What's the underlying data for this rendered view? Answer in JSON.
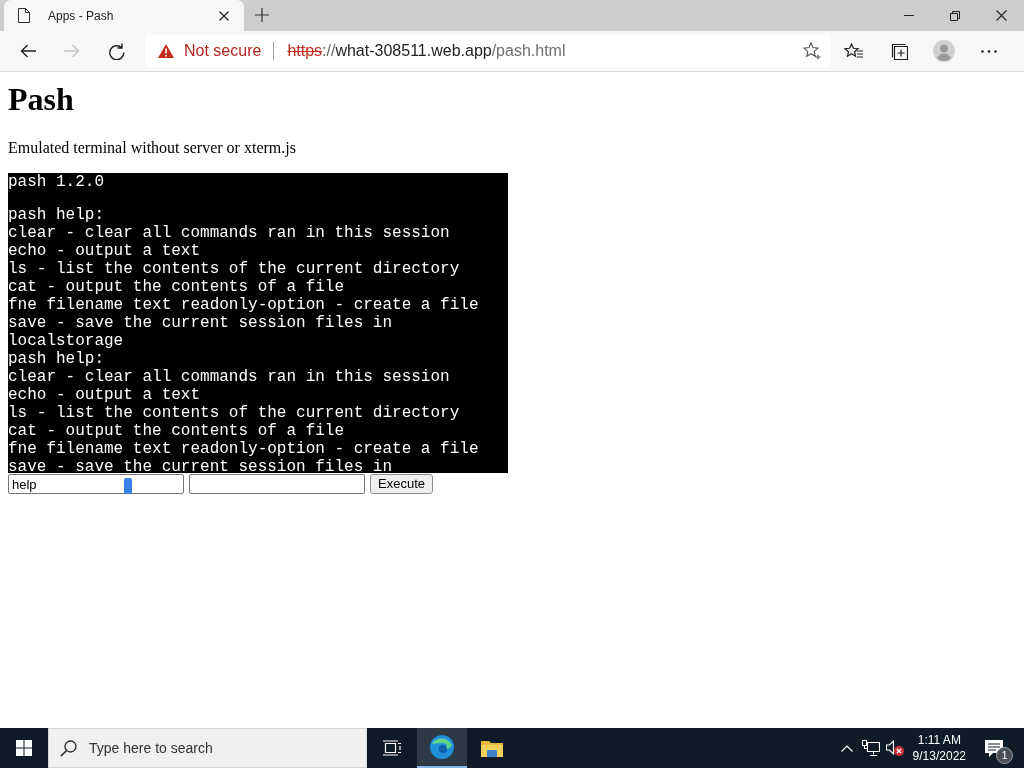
{
  "browser": {
    "tabs": [
      {
        "title": "Apps - Pash",
        "selected": true
      }
    ],
    "nav": [
      {
        "kind": "back",
        "disabled": false
      },
      {
        "kind": "forward",
        "disabled": true
      },
      {
        "kind": "refresh",
        "disabled": false
      }
    ],
    "address": {
      "security": "Not secure",
      "url": [
        {
          "kind": "scheme",
          "text": "https"
        },
        {
          "kind": "separator",
          "text": "://"
        },
        {
          "kind": "host",
          "text": "what-308511.web.app"
        },
        {
          "kind": "path",
          "text": "/pash.html"
        }
      ]
    }
  },
  "page": {
    "heading": "Pash",
    "description": "Emulated terminal without server or xterm.js",
    "terminal": {
      "banner": "pash 1.2.0",
      "lines": [
        "pash help:",
        "clear - clear all commands ran in this session",
        "echo - output a text",
        "ls - list the contents of the current directory",
        "cat - output the contents of a file",
        "fne filename text readonly-option - create a file",
        "save - save the current session files in localstorage",
        "pash help:",
        "clear - clear all commands ran in this session",
        "echo - output a text",
        "ls - list the contents of the current directory",
        "cat - output the contents of a file",
        "fne filename text readonly-option - create a file",
        "save - save the current session files in"
      ]
    },
    "command_field": {
      "value": "help"
    },
    "execute_button": "Execute"
  },
  "taskbar": {
    "search_placeholder": "Type here to search",
    "apps": [
      {
        "kind": "task-view",
        "selected": false
      },
      {
        "kind": "browser",
        "selected": true
      },
      {
        "kind": "folder",
        "selected": false
      }
    ],
    "tray": {
      "volume_muted": true
    },
    "clock": {
      "time": "1:11 AM",
      "date": "9/13/2022"
    },
    "notifications": {
      "badge": "1"
    }
  }
}
